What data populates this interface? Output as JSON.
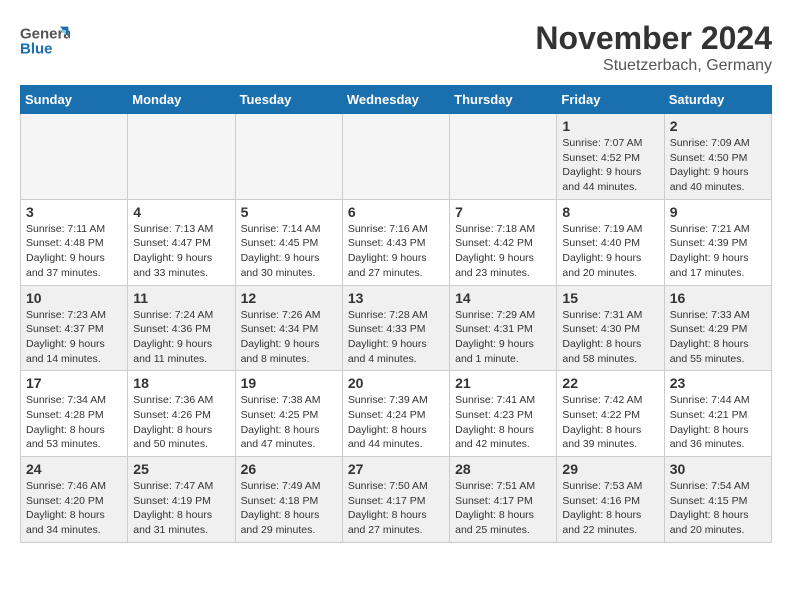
{
  "header": {
    "logo_text_general": "General",
    "logo_text_blue": "Blue",
    "month_title": "November 2024",
    "location": "Stuetzerbach, Germany"
  },
  "weekdays": [
    "Sunday",
    "Monday",
    "Tuesday",
    "Wednesday",
    "Thursday",
    "Friday",
    "Saturday"
  ],
  "weeks": [
    [
      {
        "day": "",
        "info": ""
      },
      {
        "day": "",
        "info": ""
      },
      {
        "day": "",
        "info": ""
      },
      {
        "day": "",
        "info": ""
      },
      {
        "day": "",
        "info": ""
      },
      {
        "day": "1",
        "info": "Sunrise: 7:07 AM\nSunset: 4:52 PM\nDaylight: 9 hours\nand 44 minutes."
      },
      {
        "day": "2",
        "info": "Sunrise: 7:09 AM\nSunset: 4:50 PM\nDaylight: 9 hours\nand 40 minutes."
      }
    ],
    [
      {
        "day": "3",
        "info": "Sunrise: 7:11 AM\nSunset: 4:48 PM\nDaylight: 9 hours\nand 37 minutes."
      },
      {
        "day": "4",
        "info": "Sunrise: 7:13 AM\nSunset: 4:47 PM\nDaylight: 9 hours\nand 33 minutes."
      },
      {
        "day": "5",
        "info": "Sunrise: 7:14 AM\nSunset: 4:45 PM\nDaylight: 9 hours\nand 30 minutes."
      },
      {
        "day": "6",
        "info": "Sunrise: 7:16 AM\nSunset: 4:43 PM\nDaylight: 9 hours\nand 27 minutes."
      },
      {
        "day": "7",
        "info": "Sunrise: 7:18 AM\nSunset: 4:42 PM\nDaylight: 9 hours\nand 23 minutes."
      },
      {
        "day": "8",
        "info": "Sunrise: 7:19 AM\nSunset: 4:40 PM\nDaylight: 9 hours\nand 20 minutes."
      },
      {
        "day": "9",
        "info": "Sunrise: 7:21 AM\nSunset: 4:39 PM\nDaylight: 9 hours\nand 17 minutes."
      }
    ],
    [
      {
        "day": "10",
        "info": "Sunrise: 7:23 AM\nSunset: 4:37 PM\nDaylight: 9 hours\nand 14 minutes."
      },
      {
        "day": "11",
        "info": "Sunrise: 7:24 AM\nSunset: 4:36 PM\nDaylight: 9 hours\nand 11 minutes."
      },
      {
        "day": "12",
        "info": "Sunrise: 7:26 AM\nSunset: 4:34 PM\nDaylight: 9 hours\nand 8 minutes."
      },
      {
        "day": "13",
        "info": "Sunrise: 7:28 AM\nSunset: 4:33 PM\nDaylight: 9 hours\nand 4 minutes."
      },
      {
        "day": "14",
        "info": "Sunrise: 7:29 AM\nSunset: 4:31 PM\nDaylight: 9 hours\nand 1 minute."
      },
      {
        "day": "15",
        "info": "Sunrise: 7:31 AM\nSunset: 4:30 PM\nDaylight: 8 hours\nand 58 minutes."
      },
      {
        "day": "16",
        "info": "Sunrise: 7:33 AM\nSunset: 4:29 PM\nDaylight: 8 hours\nand 55 minutes."
      }
    ],
    [
      {
        "day": "17",
        "info": "Sunrise: 7:34 AM\nSunset: 4:28 PM\nDaylight: 8 hours\nand 53 minutes."
      },
      {
        "day": "18",
        "info": "Sunrise: 7:36 AM\nSunset: 4:26 PM\nDaylight: 8 hours\nand 50 minutes."
      },
      {
        "day": "19",
        "info": "Sunrise: 7:38 AM\nSunset: 4:25 PM\nDaylight: 8 hours\nand 47 minutes."
      },
      {
        "day": "20",
        "info": "Sunrise: 7:39 AM\nSunset: 4:24 PM\nDaylight: 8 hours\nand 44 minutes."
      },
      {
        "day": "21",
        "info": "Sunrise: 7:41 AM\nSunset: 4:23 PM\nDaylight: 8 hours\nand 42 minutes."
      },
      {
        "day": "22",
        "info": "Sunrise: 7:42 AM\nSunset: 4:22 PM\nDaylight: 8 hours\nand 39 minutes."
      },
      {
        "day": "23",
        "info": "Sunrise: 7:44 AM\nSunset: 4:21 PM\nDaylight: 8 hours\nand 36 minutes."
      }
    ],
    [
      {
        "day": "24",
        "info": "Sunrise: 7:46 AM\nSunset: 4:20 PM\nDaylight: 8 hours\nand 34 minutes."
      },
      {
        "day": "25",
        "info": "Sunrise: 7:47 AM\nSunset: 4:19 PM\nDaylight: 8 hours\nand 31 minutes."
      },
      {
        "day": "26",
        "info": "Sunrise: 7:49 AM\nSunset: 4:18 PM\nDaylight: 8 hours\nand 29 minutes."
      },
      {
        "day": "27",
        "info": "Sunrise: 7:50 AM\nSunset: 4:17 PM\nDaylight: 8 hours\nand 27 minutes."
      },
      {
        "day": "28",
        "info": "Sunrise: 7:51 AM\nSunset: 4:17 PM\nDaylight: 8 hours\nand 25 minutes."
      },
      {
        "day": "29",
        "info": "Sunrise: 7:53 AM\nSunset: 4:16 PM\nDaylight: 8 hours\nand 22 minutes."
      },
      {
        "day": "30",
        "info": "Sunrise: 7:54 AM\nSunset: 4:15 PM\nDaylight: 8 hours\nand 20 minutes."
      }
    ]
  ]
}
